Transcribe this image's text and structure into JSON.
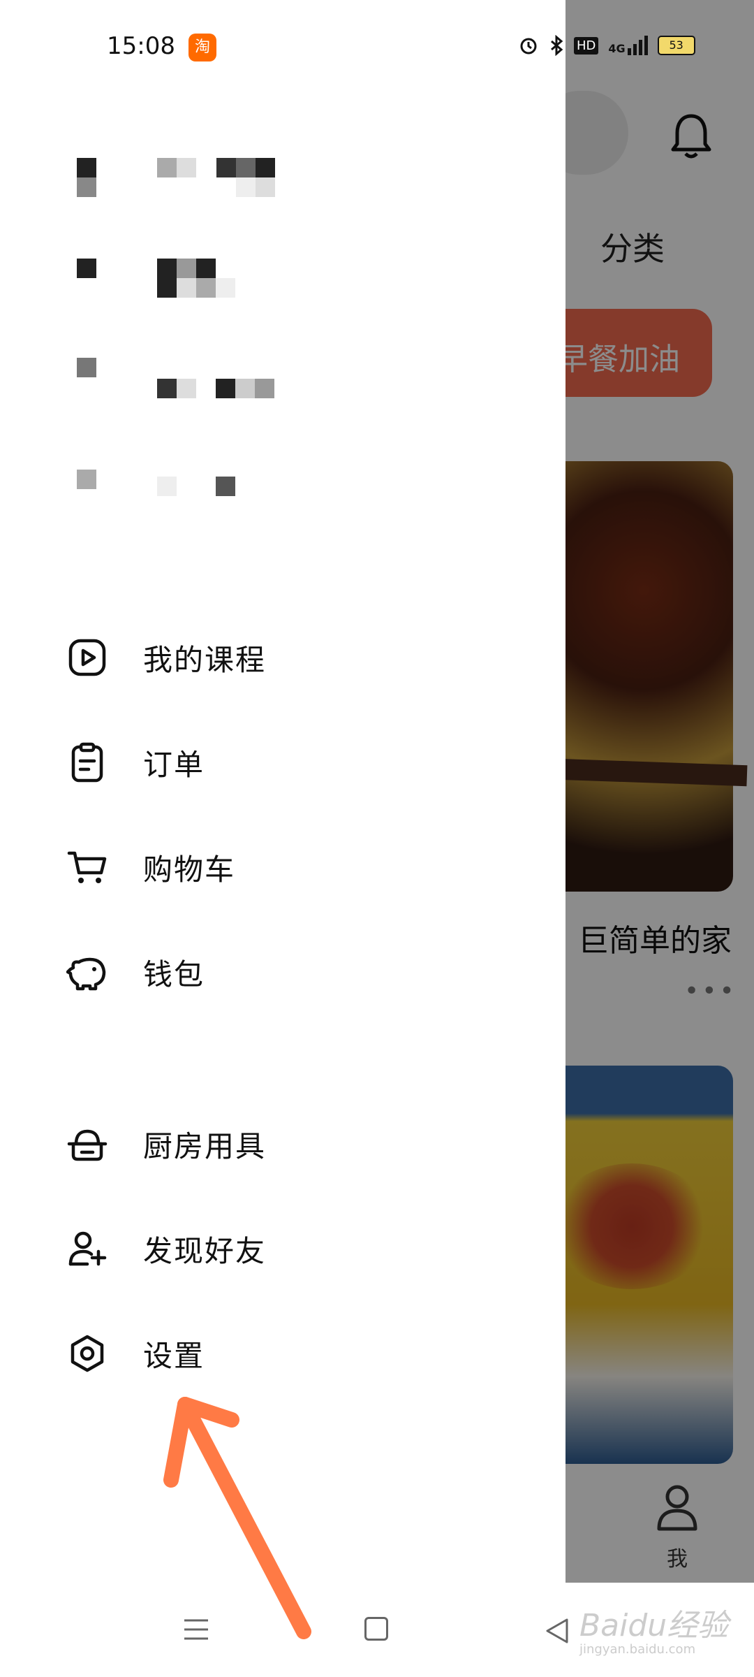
{
  "status_bar": {
    "time": "15:08",
    "app_badge": "淘",
    "icons": [
      "alarm-icon",
      "bluetooth-icon",
      "hd-icon",
      "signal-4g-icon",
      "battery-icon"
    ],
    "hd_label": "HD",
    "network_label": "4G",
    "battery_level": "53"
  },
  "background_app": {
    "category_label": "分类",
    "promo_text": "早餐加油",
    "recipe_title": "巨简单的家",
    "more_label": "•••",
    "tab_me_label": "我"
  },
  "drawer": {
    "menu_group_1": [
      {
        "label": "我的课程",
        "icon": "play-course-icon"
      },
      {
        "label": "订单",
        "icon": "clipboard-icon"
      },
      {
        "label": "购物车",
        "icon": "cart-icon"
      },
      {
        "label": "钱包",
        "icon": "piggy-bank-icon"
      }
    ],
    "menu_group_2": [
      {
        "label": "厨房用具",
        "icon": "kitchenware-icon"
      },
      {
        "label": "发现好友",
        "icon": "add-friend-icon"
      },
      {
        "label": "设置",
        "icon": "settings-icon"
      }
    ]
  },
  "colors": {
    "accent_arrow": "#FF7A45",
    "promo": "#F26A4F",
    "text": "#111111"
  },
  "watermark": {
    "text": "Baidu经验",
    "sub": "jingyan.baidu.com"
  }
}
